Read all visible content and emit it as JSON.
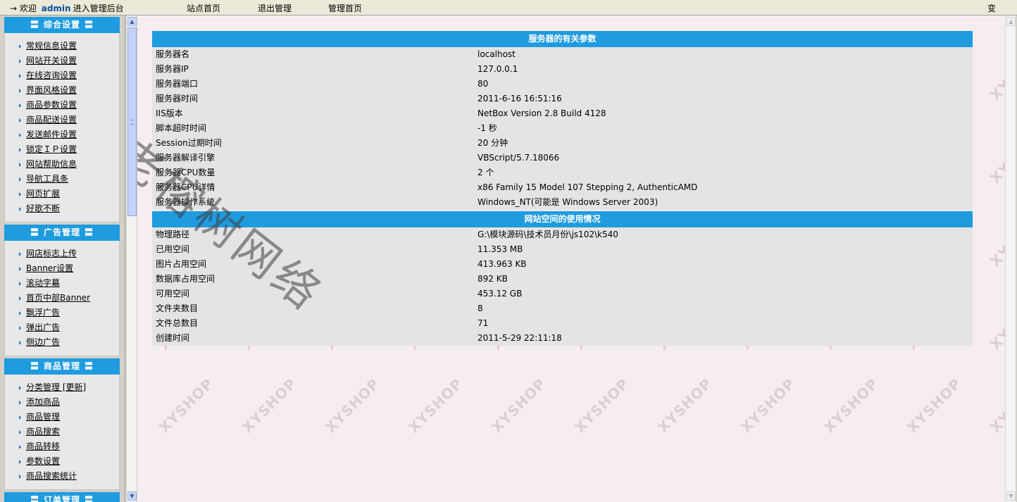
{
  "topbar": {
    "arrow": "→",
    "welcome_prefix": "欢迎",
    "username": "admin",
    "welcome_suffix": "进入管理后台",
    "nav": [
      "站点首页",
      "退出管理",
      "管理首页"
    ],
    "right_text": "变"
  },
  "sidebar": {
    "sections": [
      {
        "title": "综合设置",
        "items": [
          "常规信息设置",
          "网站开关设置",
          "在线咨询设置",
          "界面风格设置",
          "商品参数设置",
          "商品配送设置",
          "发送邮件设置",
          "锁定ＩＰ设置",
          "网站帮助信息",
          "导航工具条",
          "网页扩展",
          "好歌不断"
        ]
      },
      {
        "title": "广告管理",
        "items": [
          "网店标志上传",
          "Banner设置",
          "滚动字幕",
          "首页中部Banner",
          "飘浮广告",
          "弹出广告",
          "侧边广告"
        ]
      },
      {
        "title": "商品管理",
        "items": [
          "分类管理 [更新]",
          "添加商品",
          "商品管理",
          "商品搜索",
          "商品转移",
          "参数设置",
          "商品搜索统计"
        ]
      },
      {
        "title": "订单管理",
        "items": []
      }
    ],
    "title_bars": "〓"
  },
  "server_panel": {
    "title": "服务器的有关参数",
    "rows": [
      {
        "label": "服务器名",
        "value": "localhost"
      },
      {
        "label": "服务器IP",
        "value": "127.0.0.1"
      },
      {
        "label": "服务器端口",
        "value": "80"
      },
      {
        "label": "服务器时间",
        "value": "2011-6-16 16:51:16"
      },
      {
        "label": "IIS版本",
        "value": "NetBox Version 2.8 Build 4128"
      },
      {
        "label": "脚本超时时间",
        "value": "-1 秒"
      },
      {
        "label": "Session过期时间",
        "value": "20 分钟"
      },
      {
        "label": "服务器解译引擎",
        "value": "VBScript/5.7.18066"
      },
      {
        "label": "服务器CPU数量",
        "value": "2 个"
      },
      {
        "label": "服务器CPU详情",
        "value": "x86 Family 15 Model 107 Stepping 2, AuthenticAMD"
      },
      {
        "label": "服务器操作系统",
        "value": "Windows_NT(可能是 Windows Server 2003)"
      }
    ]
  },
  "space_panel": {
    "title": "网站空间的使用情况",
    "rows": [
      {
        "label": "物理路径",
        "value": "G:\\模块源码\\技术员月份\\js102\\k540"
      },
      {
        "label": "已用空间",
        "value": "11.353 MB"
      },
      {
        "label": "图片占用空间",
        "value": "413.963 KB"
      },
      {
        "label": "数据库占用空间",
        "value": "892 KB"
      },
      {
        "label": "可用空间",
        "value": "453.12 GB"
      },
      {
        "label": "文件夹数目",
        "value": "8"
      },
      {
        "label": "文件总数目",
        "value": "71"
      },
      {
        "label": "创建时间",
        "value": "2011-5-29 22:11:18"
      }
    ]
  },
  "watermark": {
    "tile_text": "XYSHOP",
    "overlay_text": "老榕树网络"
  },
  "colors": {
    "header_blue": "#1f9be0",
    "row_bg": "#e4e4e4",
    "content_bg": "#f5edf0",
    "username_blue": "#0a4f9e"
  }
}
